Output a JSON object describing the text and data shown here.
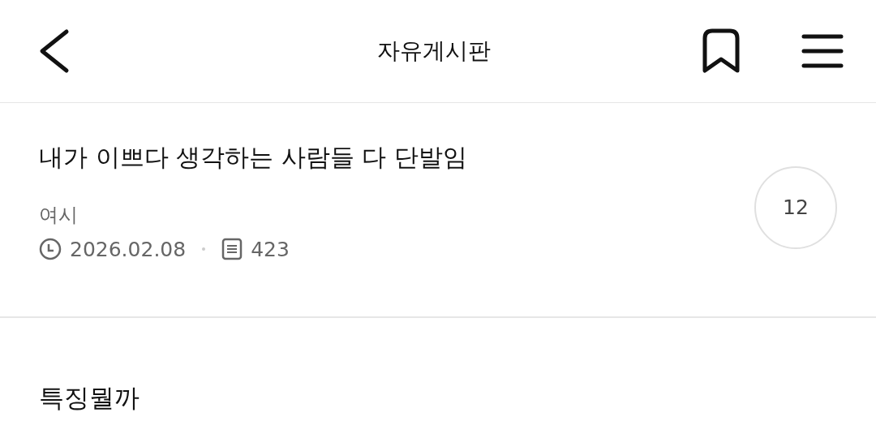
{
  "header": {
    "title": "자유게시판"
  },
  "post": {
    "title": "내가 이쁘다 생각하는 사람들 다 단발임",
    "author": "여시",
    "date": "2026.02.08",
    "views": "423",
    "comment_count": "12"
  },
  "body": {
    "text": "특징뭘까"
  }
}
